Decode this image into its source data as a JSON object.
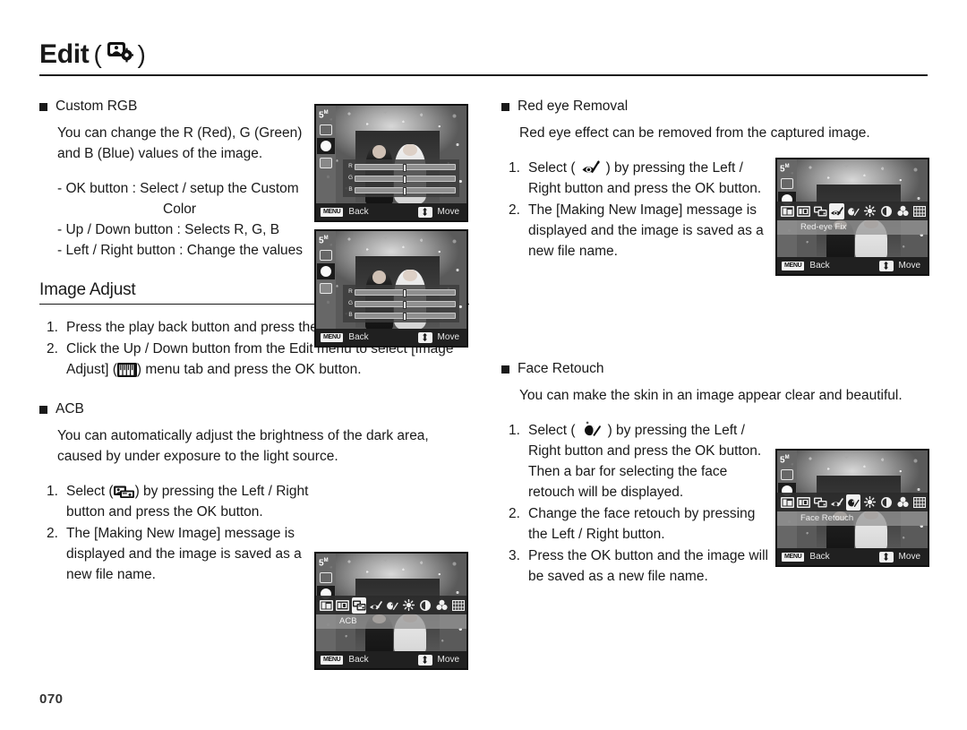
{
  "header": {
    "title": "Edit",
    "paren_open": "(",
    "paren_close": ")",
    "icon": "image-edit-gear-icon"
  },
  "page_number": "070",
  "left_column": {
    "custom_rgb": {
      "heading": "Custom RGB",
      "paragraph": "You can change the R (Red), G (Green) and B (Blue) values of the image.",
      "dash_items": [
        "- OK button : Select / setup the Custom",
        "Color",
        "- Up / Down button : Selects R, G, B",
        "- Left / Right button : Change the values"
      ]
    },
    "image_adjust": {
      "section_title": "Image Adjust",
      "steps": [
        {
          "num": "1.",
          "text": "Press the play back button and press the MENU button."
        },
        {
          "num": "2.",
          "text_before": "Click the Up / Down button from the Edit menu to select [Image Adjust] (",
          "icon": "image-adjust-sliders-icon",
          "text_after": ") menu tab and press the OK button."
        }
      ]
    },
    "acb": {
      "heading": "ACB",
      "paragraph": "You can automatically adjust the brightness of the dark area, caused by under exposure to the light source.",
      "steps": [
        {
          "num": "1.",
          "text_before": "Select (",
          "icon": "acb-icon",
          "text_after": ") by pressing the Left / Right button and press the OK button."
        },
        {
          "num": "2.",
          "text": "The [Making New Image] message is displayed and the image is saved as a new file name."
        }
      ]
    }
  },
  "right_column": {
    "red_eye": {
      "heading": "Red eye Removal",
      "paragraph": "Red eye effect can be removed from the captured image.",
      "steps": [
        {
          "num": "1.",
          "text_before": "Select (",
          "icon": "red-eye-removal-icon",
          "text_after": ") by pressing the Left / Right button and press the OK button."
        },
        {
          "num": "2.",
          "text": "The [Making New Image] message is displayed and the image is saved as a new file name."
        }
      ]
    },
    "face_retouch": {
      "heading": "Face Retouch",
      "paragraph": "You can make the skin in an image appear clear and beautiful.",
      "steps": [
        {
          "num": "1.",
          "text_before": "Select (",
          "icon": "face-retouch-icon",
          "text_after": ") by pressing the Left / Right button and press the OK button. Then a bar for selecting the face retouch will be displayed."
        },
        {
          "num": "2.",
          "text": "Change the face retouch by pressing the Left / Right button."
        },
        {
          "num": "3.",
          "text": "Press the OK button and the image will be saved as a new file name."
        }
      ]
    }
  },
  "lcd_screens": {
    "common": {
      "resolution_badge": "5",
      "resolution_unit": "M",
      "menu_chip": "MENU",
      "back_label": "Back",
      "move_label": "Move"
    },
    "custom_rgb_1": {
      "name": "custom-rgb-screen-1",
      "rgb_rows": [
        {
          "key": "R",
          "value_pos": 50
        },
        {
          "key": "G",
          "value_pos": 50
        },
        {
          "key": "B",
          "value_pos": 50
        }
      ]
    },
    "custom_rgb_2": {
      "name": "custom-rgb-screen-2",
      "rgb_rows": [
        {
          "key": "R",
          "value_pos": 50
        },
        {
          "key": "G",
          "value_pos": 50
        },
        {
          "key": "B",
          "value_pos": 50
        }
      ]
    },
    "acb": {
      "name": "acb-screen",
      "label": "ACB",
      "selected_index": 2
    },
    "red_eye": {
      "name": "red-eye-fix-screen",
      "label": "Red-eye Fix",
      "selected_index": 3
    },
    "face_retouch": {
      "name": "face-retouch-screen",
      "label": "Face Retouch",
      "selected_index": 4
    },
    "toolbar_icons": [
      "resize-icon",
      "rotate-icon",
      "acb-icon",
      "red-eye-icon",
      "face-retouch-icon",
      "brightness-icon",
      "contrast-icon",
      "saturation-icon",
      "noise-icon"
    ]
  }
}
